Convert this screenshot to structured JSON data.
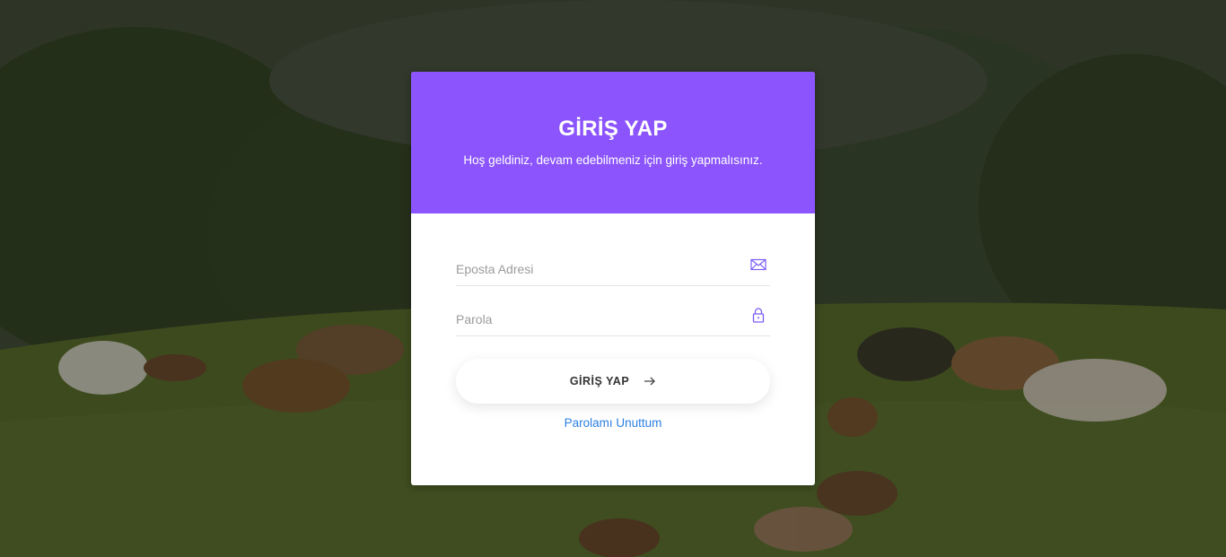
{
  "header": {
    "title": "GİRİŞ YAP",
    "subtitle": "Hoş geldiniz, devam edebilmeniz için giriş yapmalısınız."
  },
  "form": {
    "email_placeholder": "Eposta Adresi",
    "email_icon": "envelope-icon",
    "password_placeholder": "Parola",
    "password_icon": "lock-icon",
    "submit_label": "GİRİŞ YAP",
    "submit_icon": "arrow-right-icon",
    "forgot_label": "Parolamı Unuttum"
  },
  "colors": {
    "accent": "#8b54fc",
    "link": "#2b7fe3",
    "icon": "#7c5cf5"
  },
  "background": {
    "scene": "cows-on-pasture"
  }
}
